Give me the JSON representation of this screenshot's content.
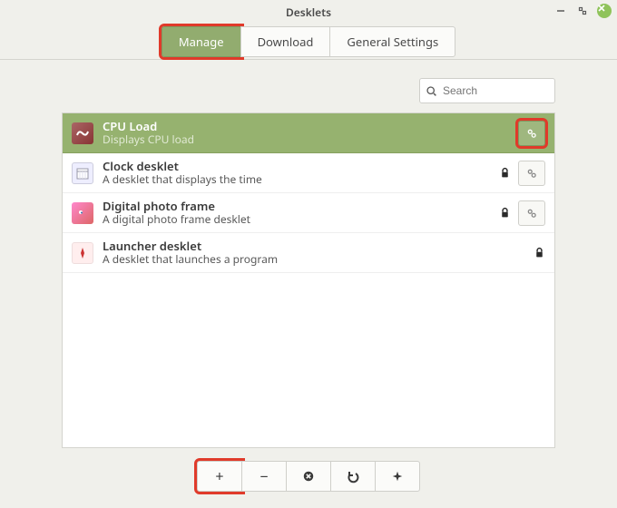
{
  "window": {
    "title": "Desklets"
  },
  "tabs": {
    "manage": {
      "label": "Manage",
      "active": true
    },
    "download": {
      "label": "Download",
      "active": false
    },
    "general": {
      "label": "General Settings",
      "active": false
    }
  },
  "search": {
    "placeholder": "Search",
    "value": ""
  },
  "desklets": [
    {
      "title": "CPU Load",
      "desc": "Displays CPU load",
      "selected": true,
      "locked": false,
      "has_settings": true,
      "icon": "cpu"
    },
    {
      "title": "Clock desklet",
      "desc": "A desklet that displays the time",
      "selected": false,
      "locked": true,
      "has_settings": true,
      "icon": "clock"
    },
    {
      "title": "Digital photo frame",
      "desc": "A digital photo frame desklet",
      "selected": false,
      "locked": true,
      "has_settings": true,
      "icon": "photo"
    },
    {
      "title": "Launcher desklet",
      "desc": "A desklet that launches a program",
      "selected": false,
      "locked": true,
      "has_settings": false,
      "icon": "launch"
    }
  ],
  "toolbar": {
    "add": {
      "glyph": "+"
    },
    "remove": {
      "glyph": "−"
    },
    "delete": {
      "glyph": "✖"
    },
    "undo": {
      "glyph": "↶"
    },
    "puzzle": {
      "glyph": "✦"
    }
  },
  "highlights": {
    "tab_manage": true,
    "row0_settings": true,
    "toolbar_add": true
  }
}
